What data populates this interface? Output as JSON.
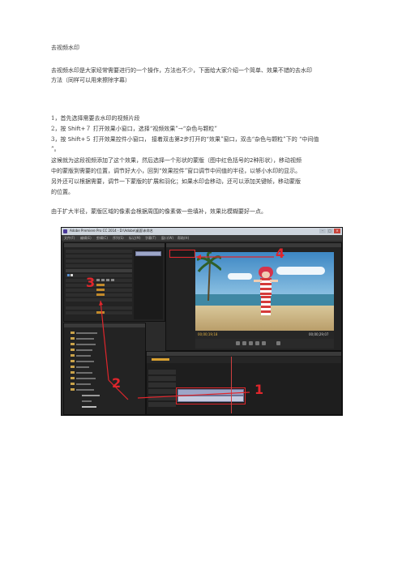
{
  "doc": {
    "title": "去视频水印",
    "intro_line1": "去视频水印是大家经常需要进行的一个操作，方法也不少，下面给大家介绍一个简单、效果不错的去水印",
    "intro_line2": "方法（同样可以用来擦除字幕）",
    "step1": "1，首先选择需要去水印的视频片段",
    "step2_num": "2，按",
    "step2_key": "Shift+７",
    "step2_rest": "打开效果小窗口，选择“视频效果”→“杂色与颗粒”",
    "step3_num": "3，按",
    "step3_key": "Shift+５",
    "step3_mid": "打开效果控件小窗口，  接着双击第",
    "step3_num2": "2",
    "step3_rest": "步打开的“效果”窗口，双击“杂色与颗粒”下的  “中间值",
    "step3_cont": "”。",
    "para_line1a": "这候就为这段视频添加了这个效果，然后选择一个形状的蒙版（图中红色括号的",
    "para_line1_num": "2",
    "para_line1b": "种形状），移动视频",
    "para_line2": "中的蒙版到需要的位置，调节好大小，回到“效果控件”窗口调节中间值的半径，以够小水印的显示。",
    "para_line3": "另外还可以根据需要，调节一下蒙版的扩展和羽化；如果水印会移动，还可以添加关键帧，移动蒙版",
    "para_line4": "的位置。",
    "note": "由于扩大半径，蒙版区域的像素会根据周围的像素做一些填补，效果比模糊要好一点。"
  },
  "screenshot": {
    "app_title": "Adobe Premiere Pro CC 2014 - D:\\Adobe\\桌面\\未命名",
    "win_buttons": [
      "–",
      "□",
      "×"
    ],
    "menu_items": [
      "文件(F)",
      "编辑(E)",
      "剪辑(C)",
      "序列(S)",
      "标记(M)",
      "字幕(T)",
      "窗口(W)",
      "帮助(H)"
    ],
    "timecode_left": "00;00;19;18",
    "timecode_right": "00;00;29;07",
    "markers": [
      "1",
      "2",
      "3",
      "4"
    ],
    "marker_color": "#e0262c"
  }
}
